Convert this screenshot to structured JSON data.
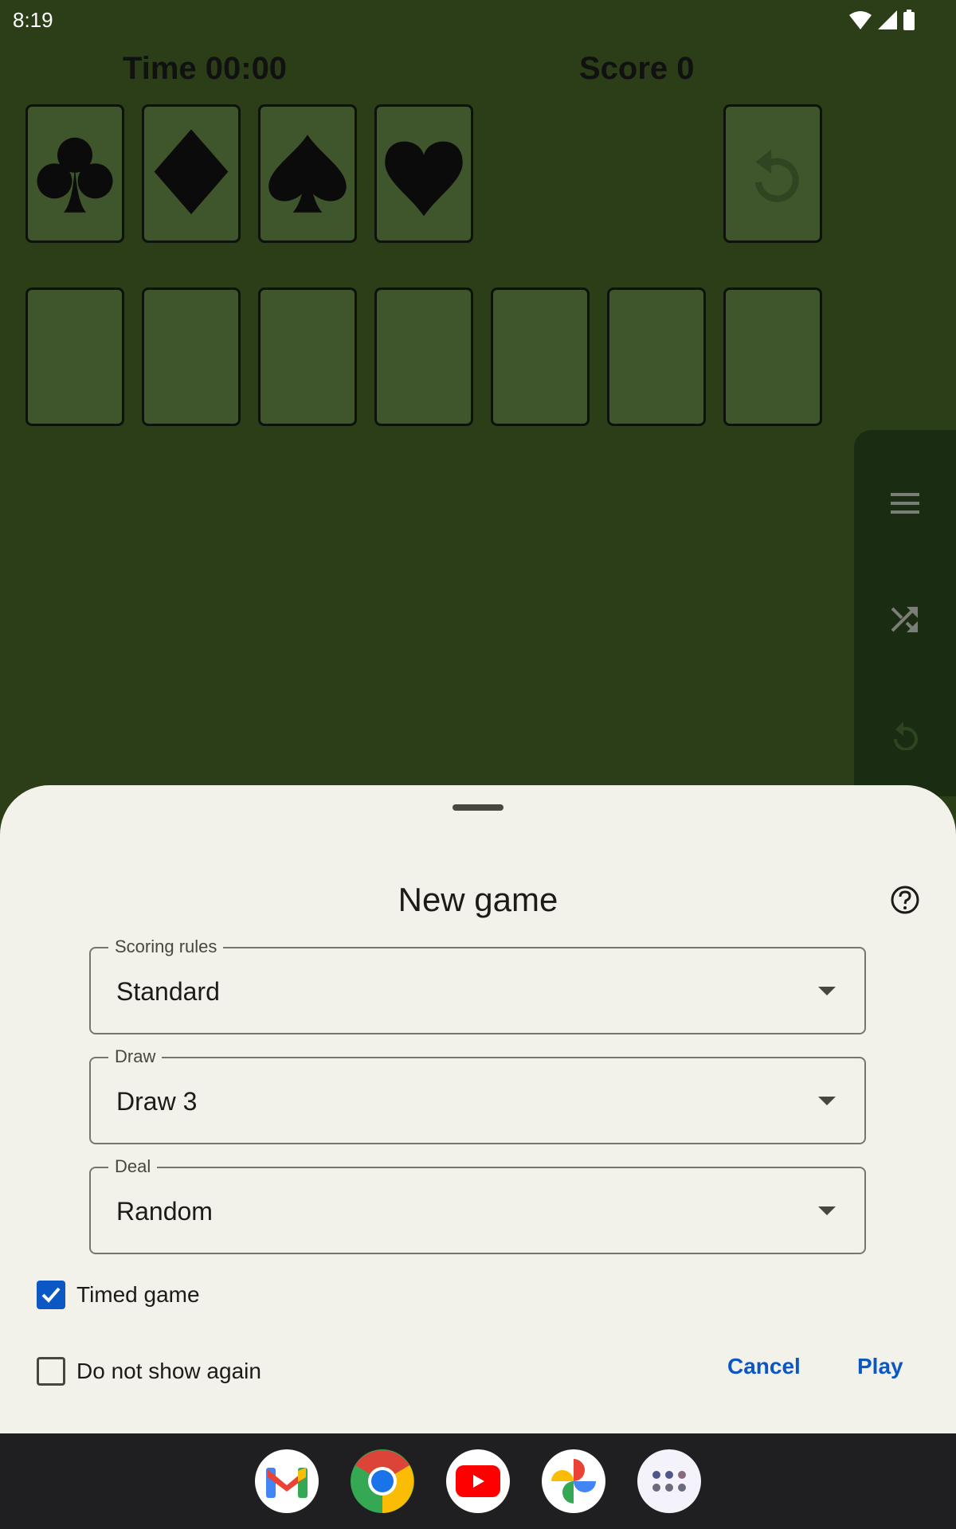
{
  "status_bar": {
    "time": "8:19",
    "icons": [
      "wifi-icon",
      "signal-icon",
      "battery-icon"
    ]
  },
  "hud": {
    "time_label": "Time 00:00",
    "score_label": "Score 0"
  },
  "foundations": [
    {
      "suit": "clubs",
      "icon": "club-icon"
    },
    {
      "suit": "diamonds",
      "icon": "diamond-icon"
    },
    {
      "suit": "spades",
      "icon": "spade-icon"
    },
    {
      "suit": "hearts",
      "icon": "heart-icon"
    }
  ],
  "stock": {
    "icon": "redeal-icon"
  },
  "tableau_columns": 7,
  "side_rail": {
    "items": [
      "menu-icon",
      "shuffle-icon",
      "undo-icon"
    ]
  },
  "dialog": {
    "title": "New game",
    "help_icon": "help-icon",
    "fields": [
      {
        "label": "Scoring rules",
        "value": "Standard"
      },
      {
        "label": "Draw",
        "value": "Draw 3"
      },
      {
        "label": "Deal",
        "value": "Random"
      }
    ],
    "checkboxes": [
      {
        "label": "Timed game",
        "checked": true
      },
      {
        "label": "Do not show again",
        "checked": false
      }
    ],
    "cancel_label": "Cancel",
    "play_label": "Play",
    "accent_color": "#0b57c4"
  },
  "dock": {
    "apps": [
      "Gmail",
      "Chrome",
      "YouTube",
      "Photos",
      "App drawer"
    ]
  }
}
